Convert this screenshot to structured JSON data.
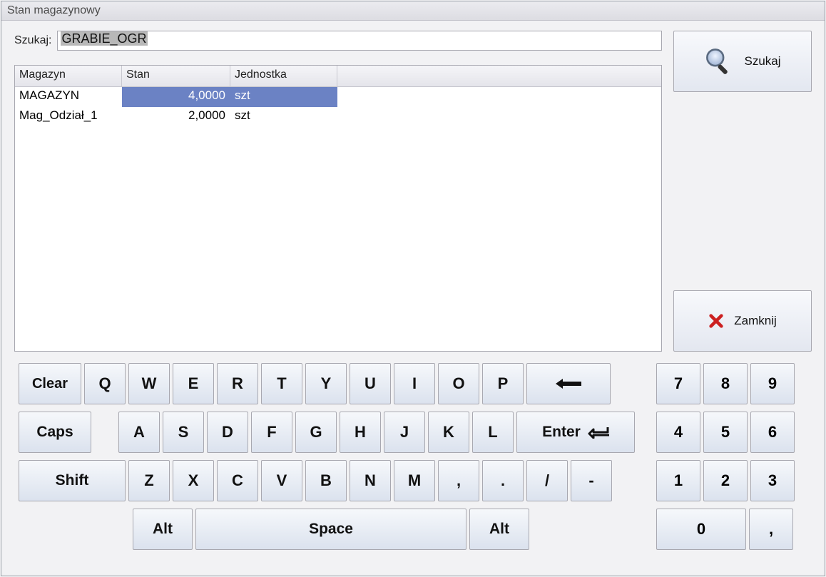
{
  "title": "Stan magazynowy",
  "search": {
    "label": "Szukaj:",
    "value": "GRABIE_OGR"
  },
  "buttons": {
    "search": "Szukaj",
    "close": "Zamknij"
  },
  "table": {
    "headers": {
      "c1": "Magazyn",
      "c2": "Stan",
      "c3": "Jednostka"
    },
    "rows": [
      {
        "c1": "MAGAZYN",
        "c2": "4,0000",
        "c3": "szt",
        "selected": true
      },
      {
        "c1": "Mag_Odział_1",
        "c2": "2,0000",
        "c3": "szt",
        "selected": false
      }
    ]
  },
  "keys": {
    "r1": [
      "Clear",
      "Q",
      "W",
      "E",
      "R",
      "T",
      "Y",
      "U",
      "I",
      "O",
      "P"
    ],
    "back": "←",
    "caps": "Caps",
    "r2": [
      "A",
      "S",
      "D",
      "F",
      "G",
      "H",
      "J",
      "K",
      "L"
    ],
    "enter": "Enter",
    "shift": "Shift",
    "r3": [
      "Z",
      "X",
      "C",
      "V",
      "B",
      "N",
      "M",
      ",",
      ".",
      "/",
      "-"
    ],
    "alt": "Alt",
    "space": "Space",
    "numr": [
      [
        "7",
        "8",
        "9"
      ],
      [
        "4",
        "5",
        "6"
      ],
      [
        "1",
        "2",
        "3"
      ]
    ],
    "zero": "0",
    "comma": ","
  }
}
